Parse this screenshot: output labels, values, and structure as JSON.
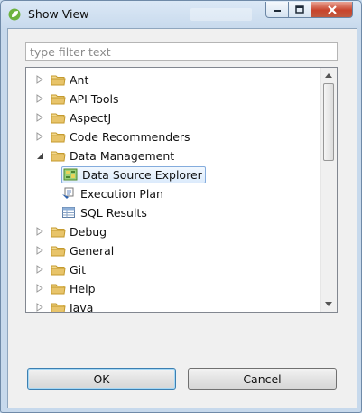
{
  "window": {
    "title": "Show View"
  },
  "filter": {
    "placeholder": "type filter text",
    "value": ""
  },
  "tree": {
    "items": [
      {
        "label": "Ant",
        "expanded": false,
        "icon": "folder-icon"
      },
      {
        "label": "API Tools",
        "expanded": false,
        "icon": "folder-icon"
      },
      {
        "label": "AspectJ",
        "expanded": false,
        "icon": "folder-icon"
      },
      {
        "label": "Code Recommenders",
        "expanded": false,
        "icon": "folder-icon"
      },
      {
        "label": "Data Management",
        "expanded": true,
        "icon": "folder-icon"
      },
      {
        "label": "Data Source Explorer",
        "child": true,
        "selected": true,
        "icon": "data-source-explorer-icon"
      },
      {
        "label": "Execution Plan",
        "child": true,
        "icon": "execution-plan-icon"
      },
      {
        "label": "SQL Results",
        "child": true,
        "icon": "sql-results-icon"
      },
      {
        "label": "Debug",
        "expanded": false,
        "icon": "folder-icon"
      },
      {
        "label": "General",
        "expanded": false,
        "icon": "folder-icon"
      },
      {
        "label": "Git",
        "expanded": false,
        "icon": "folder-icon"
      },
      {
        "label": "Help",
        "expanded": false,
        "icon": "folder-icon"
      },
      {
        "label": "Java",
        "expanded": false,
        "icon": "folder-icon"
      }
    ],
    "scroll_position": 0
  },
  "buttons": {
    "ok_label": "OK",
    "cancel_label": "Cancel"
  },
  "colors": {
    "title_bar": "#dbe8f6",
    "close_button": "#c8442c",
    "selection_border": "#84acdd",
    "folder": "#e8c46a"
  }
}
